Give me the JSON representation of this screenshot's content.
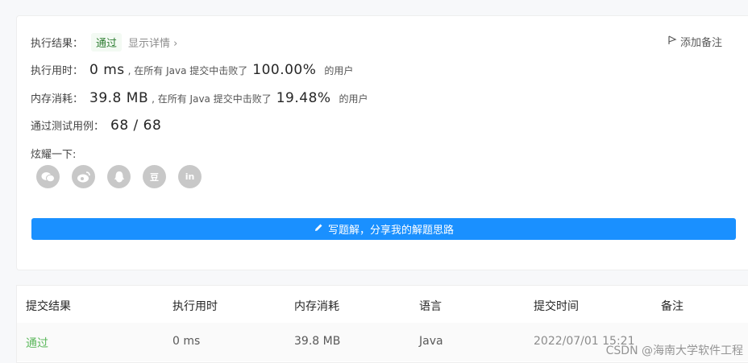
{
  "result": {
    "label": "执行结果：",
    "status": "通过",
    "detail": "显示详情 ›",
    "add_note": "添加备注"
  },
  "runtime": {
    "label": "执行用时：",
    "value": "0 ms",
    "text": ", 在所有 Java 提交中击败了",
    "percent": "100.00%",
    "suffix": "的用户"
  },
  "memory": {
    "label": "内存消耗：",
    "value": "39.8 MB",
    "text": ", 在所有 Java 提交中击败了",
    "percent": "19.48%",
    "suffix": "的用户"
  },
  "tests": {
    "label": "通过测试用例：",
    "value": "68 / 68"
  },
  "share": {
    "label": "炫耀一下:",
    "icons": [
      "wechat-icon",
      "weibo-icon",
      "qq-icon",
      "douban-icon",
      "linkedin-icon"
    ],
    "douban_glyph": "豆",
    "linkedin_glyph": "in"
  },
  "solution_button": "写题解，分享我的解题思路",
  "table": {
    "headers": [
      "提交结果",
      "执行用时",
      "内存消耗",
      "语言",
      "提交时间",
      "备注"
    ],
    "row": {
      "result": "通过",
      "runtime": "0 ms",
      "memory": "39.8 MB",
      "language": "Java",
      "time": "2022/07/01 15:21"
    }
  },
  "watermark": "CSDN @海南大学软件工程"
}
